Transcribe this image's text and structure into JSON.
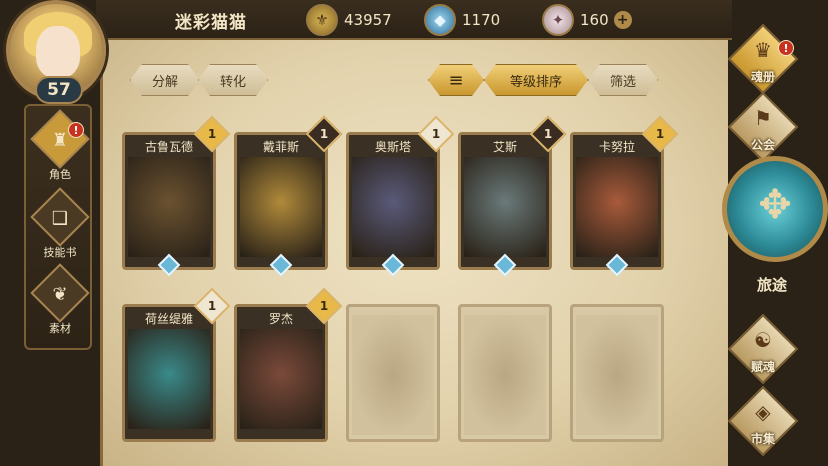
{
  "player": {
    "name": "迷彩猫猫",
    "level": "57"
  },
  "currencies": [
    {
      "icon": "gold-coin-icon",
      "glyph": "⚜",
      "value": "43957"
    },
    {
      "icon": "crystal-icon",
      "glyph": "◆",
      "value": "1170"
    },
    {
      "icon": "gem-icon",
      "glyph": "✦",
      "value": "160",
      "plus": "+"
    }
  ],
  "left_menu": [
    {
      "label": "角色",
      "icon": "character-icon",
      "glyph": "♜",
      "alert": "!"
    },
    {
      "label": "技能书",
      "icon": "skill-book-icon",
      "glyph": "❑"
    },
    {
      "label": "素材",
      "icon": "material-icon",
      "glyph": "❦"
    }
  ],
  "filters": {
    "decompose": "分解",
    "convert": "转化",
    "sort_icon": "sort-icon",
    "sort_glyph": "≡",
    "sort_by_level": "等级排序",
    "filter": "筛选"
  },
  "heroes_row1": [
    {
      "name": "古鲁瓦德",
      "stars": "1",
      "badge": "gold",
      "color": "#6b5230"
    },
    {
      "name": "戴菲斯",
      "stars": "1",
      "badge": "dark",
      "color": "#b08a3a"
    },
    {
      "name": "奥斯塔",
      "stars": "1",
      "badge": "light",
      "color": "#5a5a7a"
    },
    {
      "name": "艾斯",
      "stars": "1",
      "badge": "dark",
      "color": "#6a7a7a"
    },
    {
      "name": "卡努拉",
      "stars": "1",
      "badge": "gold",
      "color": "#a85a3a"
    }
  ],
  "heroes_row2": [
    {
      "name": "荷丝缇雅",
      "stars": "1",
      "badge": "light",
      "color": "#3a8a8a"
    },
    {
      "name": "罗杰",
      "stars": "1",
      "badge": "gold",
      "color": "#7a4a3a"
    }
  ],
  "right_nav": [
    {
      "label": "魂册",
      "icon": "soul-book-icon",
      "glyph": "♛",
      "alert": "!"
    },
    {
      "label": "公会",
      "icon": "guild-icon",
      "glyph": "⚑"
    },
    {
      "label": "赋魂",
      "icon": "soul-infuse-icon",
      "glyph": "☯"
    },
    {
      "label": "市集",
      "icon": "market-icon",
      "glyph": "◈"
    }
  ],
  "journey": {
    "label": "旅途",
    "icon": "journey-compass-icon",
    "glyph": "✥"
  }
}
